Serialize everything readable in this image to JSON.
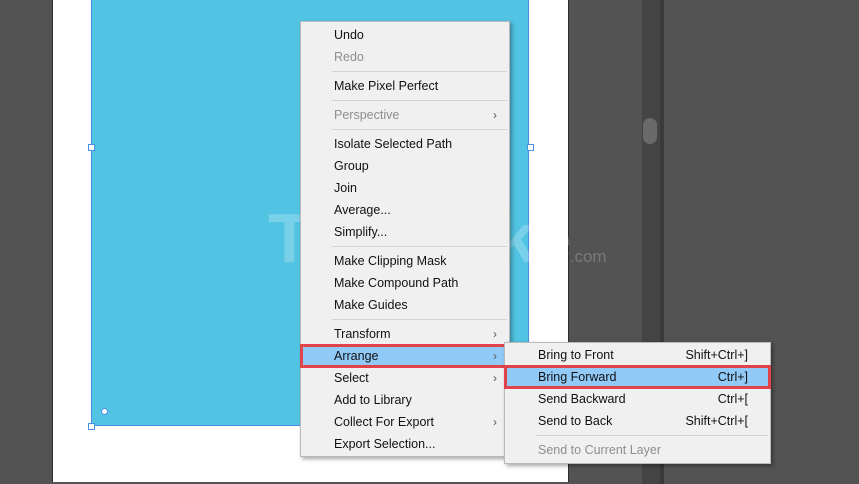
{
  "menu": {
    "groups": [
      [
        {
          "label": "Undo",
          "disabled": false
        },
        {
          "label": "Redo",
          "disabled": true
        }
      ],
      [
        {
          "label": "Make Pixel Perfect",
          "disabled": false
        }
      ],
      [
        {
          "label": "Perspective",
          "disabled": true,
          "submenu": true
        }
      ],
      [
        {
          "label": "Isolate Selected Path"
        },
        {
          "label": "Group"
        },
        {
          "label": "Join"
        },
        {
          "label": "Average..."
        },
        {
          "label": "Simplify..."
        }
      ],
      [
        {
          "label": "Make Clipping Mask"
        },
        {
          "label": "Make Compound Path"
        },
        {
          "label": "Make Guides"
        }
      ],
      [
        {
          "label": "Transform",
          "submenu": true
        },
        {
          "label": "Arrange",
          "submenu": true,
          "active": true
        },
        {
          "label": "Select",
          "submenu": true
        },
        {
          "label": "Add to Library"
        },
        {
          "label": "Collect For Export",
          "submenu": true
        },
        {
          "label": "Export Selection..."
        }
      ]
    ],
    "arrow_glyph": "›"
  },
  "submenu": {
    "items": [
      {
        "label": "Bring to Front",
        "shortcut": "Shift+Ctrl+]"
      },
      {
        "label": "Bring Forward",
        "shortcut": "Ctrl+]",
        "highlighted": true
      },
      {
        "label": "Send Backward",
        "shortcut": "Ctrl+["
      },
      {
        "label": "Send to Back",
        "shortcut": "Shift+Ctrl+["
      }
    ],
    "disabled_item": {
      "label": "Send to Current Layer"
    }
  },
  "watermark": {
    "text": "TipsMake",
    "suffix": ".com"
  },
  "colors": {
    "fill": "#52c4e3",
    "highlight": "#91c9f7",
    "callout": "#e0434a",
    "selection": "#4a90e2"
  }
}
